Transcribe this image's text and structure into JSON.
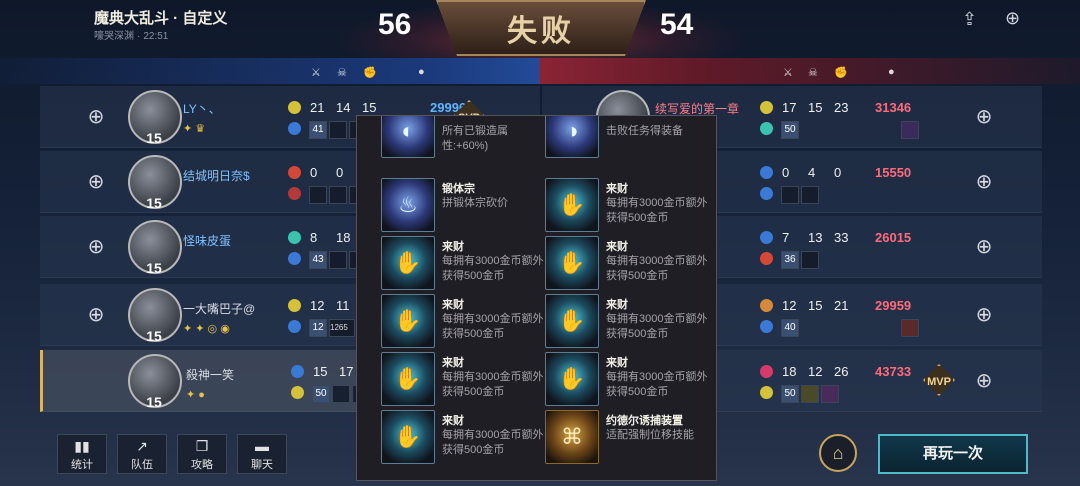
{
  "header": {
    "title": "魔典大乱斗 · 自定义",
    "subtitle_name": "嚎哭深渊",
    "subtitle_sep": "·",
    "subtitle_time": "22:51",
    "score_left": "56",
    "score_right": "54",
    "result": "失败"
  },
  "columns": {
    "kills_icon": "crossed-swords-icon",
    "deaths_icon": "skull-icon",
    "assists_icon": "fist-icon",
    "gold_icon": "gold-coin-icon"
  },
  "left_team": [
    {
      "name": "LY丶、",
      "level": "15",
      "kills": "21",
      "deaths": "14",
      "assists": "15",
      "gold": "29996",
      "item_badge": "41",
      "mvp": "SVP"
    },
    {
      "name": "结城明日奈$",
      "level": "15",
      "kills": "0",
      "deaths": "0",
      "assists": "",
      "gold": "",
      "item_badge": ""
    },
    {
      "name": "怪味皮蛋",
      "level": "15",
      "kills": "8",
      "deaths": "18",
      "assists": "",
      "gold": "",
      "item_badge": "43"
    },
    {
      "name": "一大嘴巴子@",
      "level": "15",
      "kills": "12",
      "deaths": "11",
      "assists": "",
      "gold": "",
      "item_badge": "12",
      "item_extra": "1265"
    },
    {
      "name": "殺神一笑",
      "level": "15",
      "kills": "15",
      "deaths": "17",
      "assists": "",
      "gold": "",
      "item_badge": "50"
    }
  ],
  "right_team": [
    {
      "name": "续写爱的第一章",
      "kills": "17",
      "deaths": "15",
      "assists": "23",
      "gold": "31346",
      "item_badge": "50"
    },
    {
      "name": "",
      "kills": "0",
      "deaths": "4",
      "assists": "0",
      "gold": "15550",
      "item_badge": ""
    },
    {
      "name": "",
      "kills": "7",
      "deaths": "13",
      "assists": "33",
      "gold": "26015",
      "item_badge": "36"
    },
    {
      "name": "",
      "kills": "12",
      "deaths": "15",
      "assists": "21",
      "gold": "29959",
      "item_badge": "40"
    },
    {
      "name": "",
      "kills": "18",
      "deaths": "12",
      "assists": "26",
      "gold": "43733",
      "item_badge": "50",
      "mvp": "MVP"
    }
  ],
  "popup": {
    "cards": [
      {
        "name": "",
        "desc": "所有已锻造属性:+60%)",
        "icon": "mask-icon"
      },
      {
        "name": "",
        "desc": "击败任务得装备",
        "icon": "mask-icon"
      },
      {
        "name": "锻体宗",
        "desc": "拼锻体宗砍价",
        "icon": "flame-mask-icon"
      },
      {
        "name": "来财",
        "desc": "每拥有3000金币额外获得500金币",
        "icon": "money-hands-icon"
      },
      {
        "name": "来财",
        "desc": "每拥有3000金币额外获得500金币",
        "icon": "money-hands-icon"
      },
      {
        "name": "来财",
        "desc": "每拥有3000金币额外获得500金币",
        "icon": "money-hands-icon"
      },
      {
        "name": "来财",
        "desc": "每拥有3000金币额外获得500金币",
        "icon": "money-hands-icon"
      },
      {
        "name": "来财",
        "desc": "每拥有3000金币额外获得500金币",
        "icon": "money-hands-icon"
      },
      {
        "name": "来财",
        "desc": "每拥有3000金币额外获得500金币",
        "icon": "money-hands-icon"
      },
      {
        "name": "来财",
        "desc": "每拥有3000金币额外获得500金币",
        "icon": "money-hands-icon"
      },
      {
        "name": "来财",
        "desc": "每拥有3000金币额外获得500金币",
        "icon": "money-hands-icon"
      },
      {
        "name": "约德尔诱捕装置",
        "desc": "适配强制位移技能",
        "icon": "yordle-trap-icon"
      }
    ]
  },
  "bottom": {
    "stats": "统计",
    "team": "队伍",
    "guide": "攻略",
    "chat": "聊天",
    "play_again": "再玩一次"
  },
  "colors": {
    "accent_gold": "#c8a45e",
    "blue_gold": "#5fb6ff",
    "red_gold": "#ff6a7a",
    "play_again_border": "#4fb9c9"
  }
}
